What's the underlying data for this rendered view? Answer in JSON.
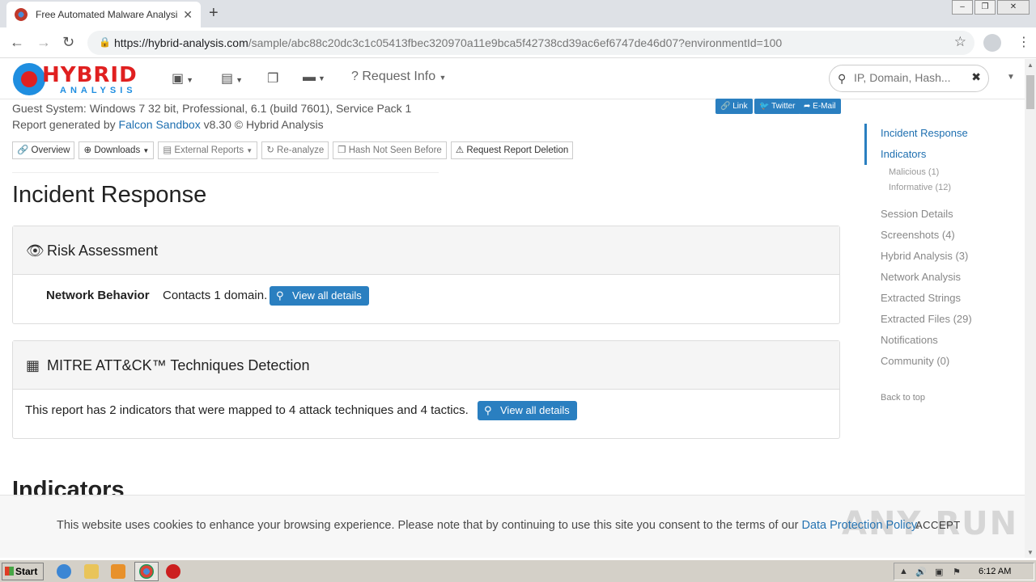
{
  "browser": {
    "tab_title": "Free Automated Malware Analysis S",
    "url_host": "https://hybrid-analysis.com",
    "url_path": "/sample/abc88c20dc3c1c05413fbec320970a11e9bca5f42738cd39ac6ef6747de46d07?environmentId=100",
    "win_min": "–",
    "win_max": "❐",
    "win_close": "✕"
  },
  "header": {
    "logo_top": "HYBRID",
    "logo_bottom": "ANALYSIS",
    "request_info": "Request Info",
    "search_placeholder": "IP, Domain, Hash..."
  },
  "report": {
    "guest_system": "Guest System: Windows 7 32 bit, Professional, 6.1 (build 7601), Service Pack 1",
    "generated_prefix": "Report generated by ",
    "generated_link": "Falcon Sandbox",
    "generated_suffix": " v8.30 © Hybrid Analysis",
    "share_link": "Link",
    "share_twitter": "Twitter",
    "share_email": "E-Mail"
  },
  "actions": {
    "overview": "Overview",
    "downloads": "Downloads",
    "external_reports": "External Reports",
    "reanalyze": "Re-analyze",
    "hash_not_seen": "Hash Not Seen Before",
    "request_deletion": "Request Report Deletion"
  },
  "incident": {
    "heading": "Incident Response",
    "risk_title": "Risk Assessment",
    "network_label": "Network Behavior",
    "network_text": "Contacts 1 domain.",
    "view_details": "View all details",
    "mitre_title": "MITRE ATT&CK™ Techniques Detection",
    "mitre_text": "This report has 2 indicators that were mapped to 4 attack techniques and 4 tactics.",
    "view_details_2": "View all details"
  },
  "indicators_heading": "Indicators",
  "toc": {
    "incident_response": "Incident Response",
    "indicators": "Indicators",
    "malicious": "Malicious (1)",
    "informative": "Informative (12)",
    "session_details": "Session Details",
    "screenshots": "Screenshots (4)",
    "hybrid_analysis": "Hybrid Analysis (3)",
    "network_analysis": "Network Analysis",
    "extracted_strings": "Extracted Strings",
    "extracted_files": "Extracted Files (29)",
    "notifications": "Notifications",
    "community": "Community (0)",
    "back_to_top": "Back to top"
  },
  "cookie": {
    "text": "This website uses cookies to enhance your browsing experience. Please note that by continuing to use this site you consent to the terms of our ",
    "link": "Data Protection Policy",
    "end": ".",
    "accept": "ACCEPT",
    "watermark": "ANY RUN"
  },
  "taskbar": {
    "start": "Start",
    "time": "6:12 AM"
  },
  "colors": {
    "accent": "#2a7fc0",
    "logo_red": "#e02020",
    "logo_blue": "#1f8ee0"
  }
}
